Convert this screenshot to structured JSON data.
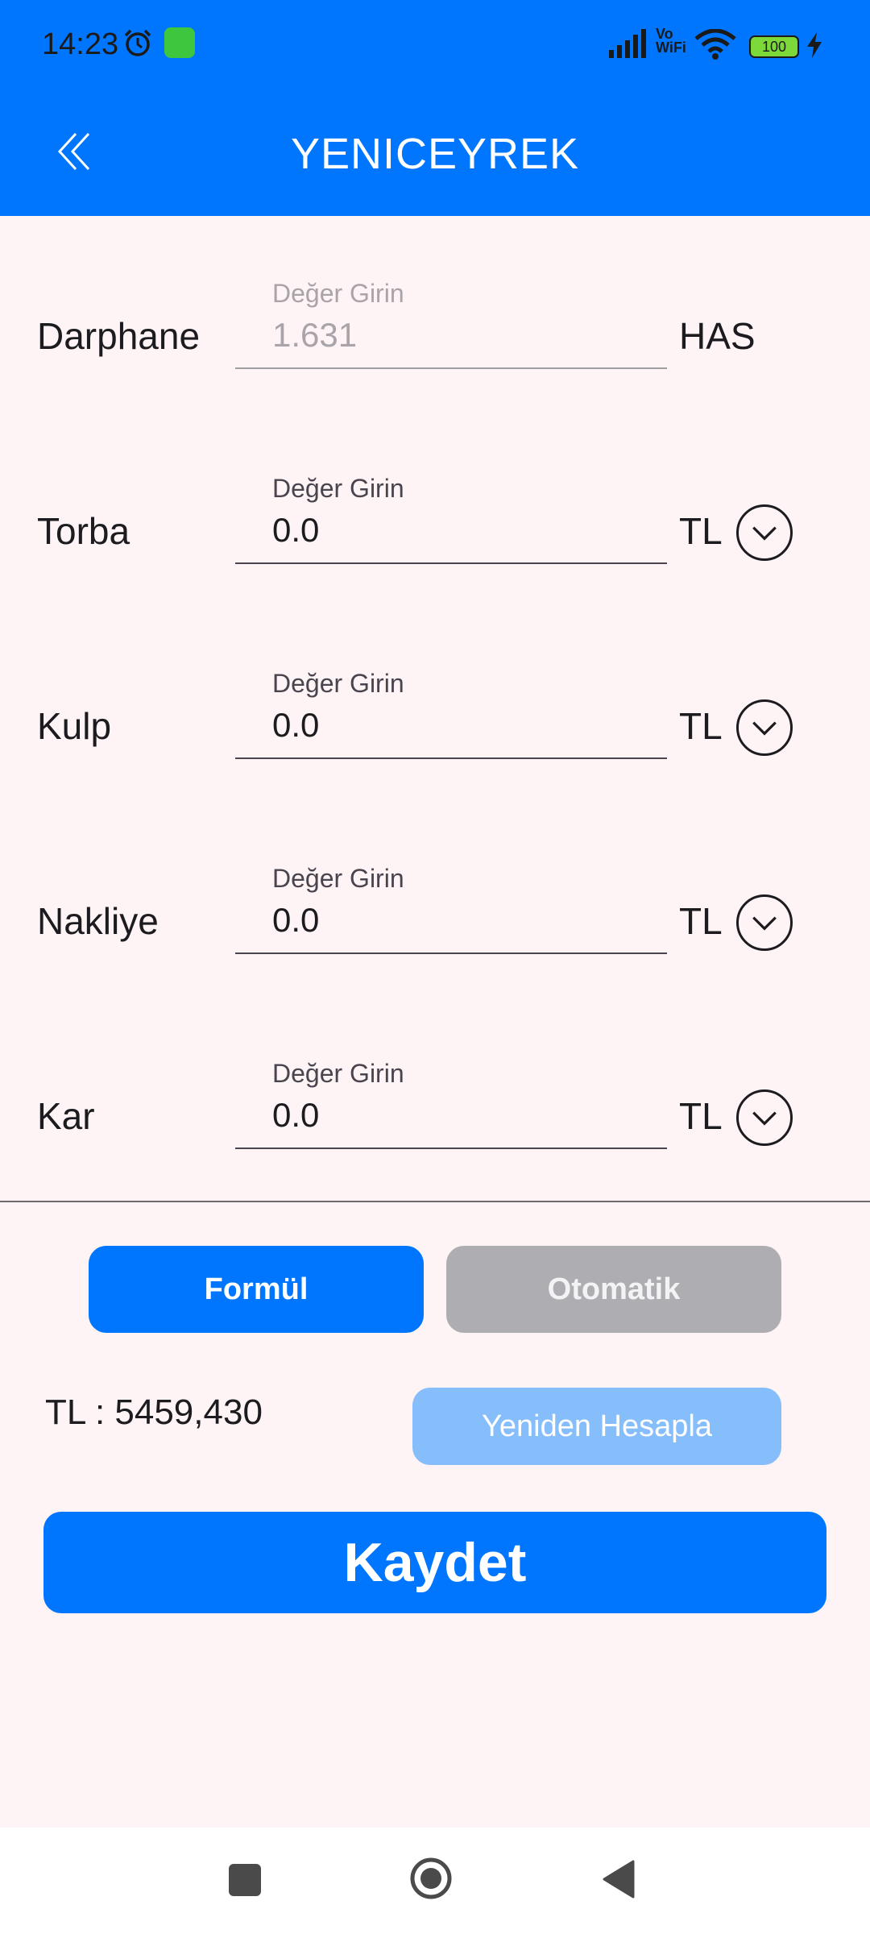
{
  "status_bar": {
    "time": "14:23",
    "vowifi_line1": "Vo",
    "vowifi_line2": "WiFi",
    "battery": "100"
  },
  "header": {
    "title": "YENICEYREK",
    "back_icon": "double-chevron-left-icon"
  },
  "fields": [
    {
      "label": "Darphane",
      "hint": "Değer Girin",
      "value": "1.631",
      "unit": "HAS",
      "disabled": true
    },
    {
      "label": "Torba",
      "hint": "Değer Girin",
      "value": "0.0",
      "unit": "TL"
    },
    {
      "label": "Kulp",
      "hint": "Değer Girin",
      "value": "0.0",
      "unit": "TL"
    },
    {
      "label": "Nakliye",
      "hint": "Değer Girin",
      "value": "0.0",
      "unit": "TL"
    },
    {
      "label": "Kar",
      "hint": "Değer Girin",
      "value": "0.0",
      "unit": "TL"
    }
  ],
  "mode_buttons": {
    "formul": "Formül",
    "otomatik": "Otomatik"
  },
  "result": {
    "text": "TL : 5459,430",
    "recalculate_label": "Yeniden Hesapla"
  },
  "save_label": "Kaydet",
  "colors": {
    "primary": "#0076fe",
    "disabled_button": "#aeadb2",
    "light_button": "#86bdfb",
    "background": "#fff4f5"
  }
}
